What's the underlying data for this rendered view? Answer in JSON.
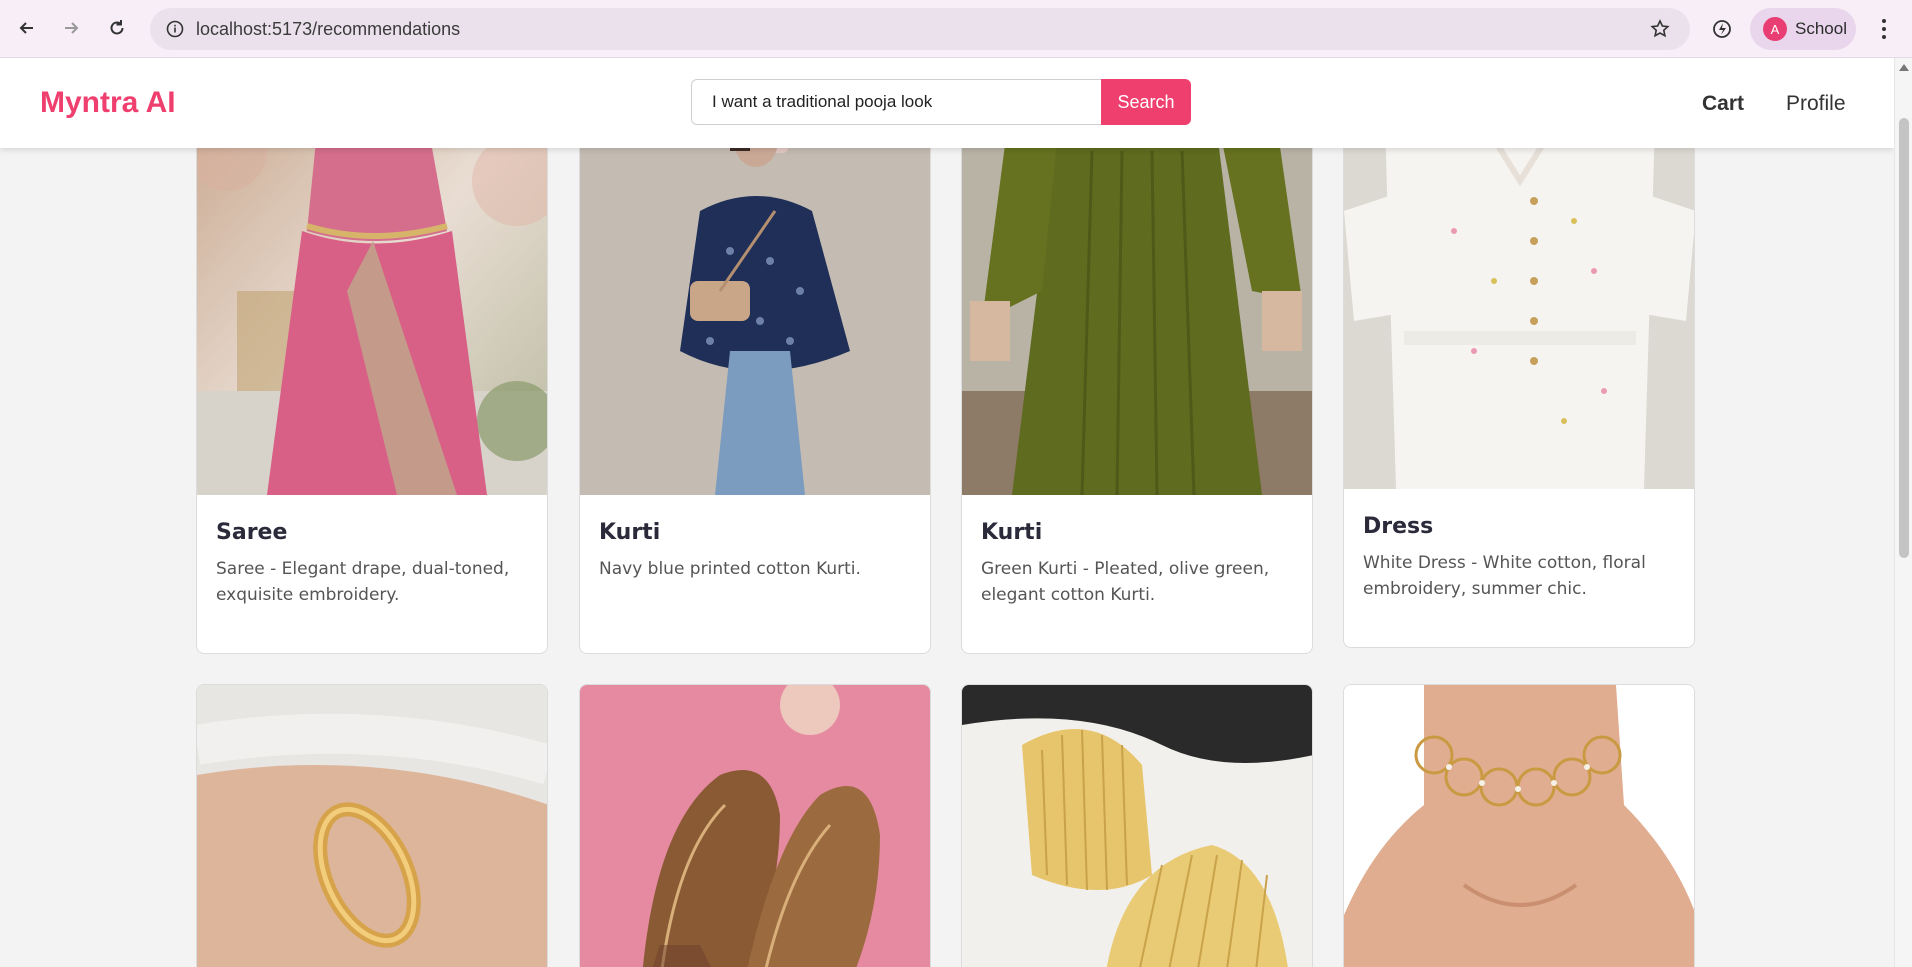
{
  "browser": {
    "url": "localhost:5173/recommendations",
    "profile_initial": "A",
    "profile_name": "School"
  },
  "header": {
    "brand": "Myntra AI",
    "search_value": "I want a traditional pooja look",
    "search_button": "Search",
    "nav": {
      "cart": "Cart",
      "profile": "Profile"
    }
  },
  "theme": {
    "accent": "#ef3f6f"
  },
  "products": [
    {
      "title": "Saree",
      "description": "Saree - Elegant drape, dual-toned, exquisite embroidery.",
      "image": "pink saree"
    },
    {
      "title": "Kurti",
      "description": "Navy blue printed cotton Kurti.",
      "image": "navy printed kurti"
    },
    {
      "title": "Kurti",
      "description": "Green Kurti - Pleated, olive green, elegant cotton Kurti.",
      "image": "olive green kurti"
    },
    {
      "title": "Dress",
      "description": "White Dress - White cotton, floral embroidery, summer chic.",
      "image": "white floral dress"
    },
    {
      "title": "",
      "description": "",
      "image": "gold bangle"
    },
    {
      "title": "",
      "description": "",
      "image": "embroidered juttis"
    },
    {
      "title": "",
      "description": "",
      "image": "gold ribbed hoop earrings"
    },
    {
      "title": "",
      "description": "",
      "image": "gold ring choker"
    }
  ]
}
